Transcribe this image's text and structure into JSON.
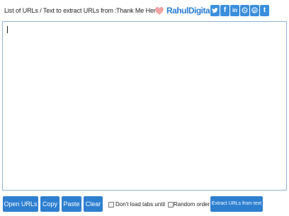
{
  "header": {
    "list_label": "List of URLs / Text to extract URLs from :",
    "thank_label": "Thank Me Here:",
    "brand": "RahulDigital",
    "social": [
      {
        "name": "twitter-icon",
        "glyph": "bird"
      },
      {
        "name": "facebook-icon",
        "glyph": "f"
      },
      {
        "name": "linkedin-icon",
        "glyph": "in"
      },
      {
        "name": "whatsapp-icon",
        "glyph": "wa"
      },
      {
        "name": "pinterest-icon",
        "glyph": "p"
      },
      {
        "name": "tumblr-icon",
        "glyph": "t"
      }
    ],
    "colors": {
      "brand": "#2a7fd4",
      "social": "#3a8edc",
      "heart": "#f2a3a3"
    }
  },
  "textarea": {
    "value": ""
  },
  "footer": {
    "open_urls": "Open URLs",
    "copy": "Copy",
    "paste": "Paste",
    "clear": "Clear",
    "dont_load_label": "Don't load tabs until",
    "random_order_label": "Random order",
    "extract": "Extract URLs from text",
    "colors": {
      "button": "#2d7fd0"
    }
  }
}
